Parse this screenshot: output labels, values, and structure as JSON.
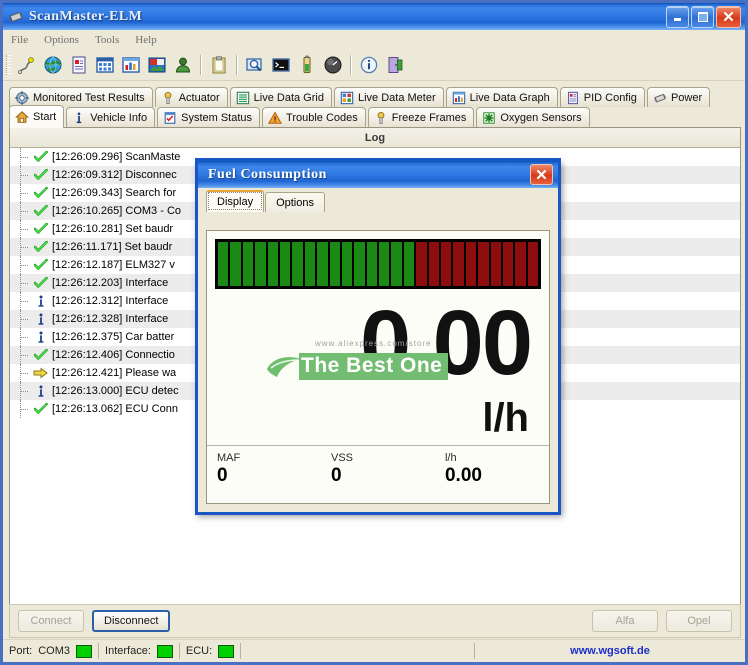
{
  "window": {
    "title": "ScanMaster-ELM",
    "icon": "chip-icon",
    "controls": {
      "minimize": "–",
      "maximize": "□",
      "close": "✕"
    }
  },
  "menubar": {
    "items": [
      "File",
      "Options",
      "Tools",
      "Help"
    ]
  },
  "toolbar": {
    "groups": [
      {
        "buttons": [
          "connect-icon",
          "globe-icon",
          "report-icon",
          "grid-icon",
          "chart-icon",
          "image-icon",
          "user-icon"
        ]
      },
      {
        "buttons": [
          "clipboard-icon",
          "terminal-search-icon",
          "console-icon",
          "battery-icon",
          "gauge-icon"
        ]
      },
      {
        "buttons": [
          "info-icon",
          "exit-icon"
        ]
      }
    ]
  },
  "tabs_top": [
    {
      "label": "Monitored Test Results",
      "icon": "gear-icon",
      "active": false
    },
    {
      "label": "Actuator",
      "icon": "actuator-icon",
      "active": false
    },
    {
      "label": "Live Data Grid",
      "icon": "list-icon",
      "active": false
    },
    {
      "label": "Live Data Meter",
      "icon": "meter-icon",
      "active": false
    },
    {
      "label": "Live Data Graph",
      "icon": "bar-chart-icon",
      "active": false
    },
    {
      "label": "PID Config",
      "icon": "pid-icon",
      "active": false
    },
    {
      "label": "Power",
      "icon": "power-icon",
      "active": false
    }
  ],
  "tabs_bottom": [
    {
      "label": "Start",
      "icon": "home-icon",
      "active": true
    },
    {
      "label": "Vehicle Info",
      "icon": "info-i-icon",
      "active": false
    },
    {
      "label": "System Status",
      "icon": "checklist-icon",
      "active": false
    },
    {
      "label": "Trouble Codes",
      "icon": "warning-icon",
      "active": false
    },
    {
      "label": "Freeze Frames",
      "icon": "freeze-icon",
      "active": false
    },
    {
      "label": "Oxygen Sensors",
      "icon": "oxygen-icon",
      "active": false
    }
  ],
  "log": {
    "header": "Log",
    "rows": [
      {
        "icon": "check-icon",
        "text": "[12:26:09.296] ScanMaste"
      },
      {
        "icon": "check-icon",
        "text": "[12:26:09.312] Disconnec"
      },
      {
        "icon": "check-icon",
        "text": "[12:26:09.343] Search for"
      },
      {
        "icon": "check-icon",
        "text": "[12:26:10.265] COM3 - Co"
      },
      {
        "icon": "check-icon",
        "text": "[12:26:10.281] Set baudr"
      },
      {
        "icon": "check-icon",
        "text": "[12:26:11.171] Set baudr"
      },
      {
        "icon": "check-icon",
        "text": "[12:26:12.187] ELM327 v"
      },
      {
        "icon": "check-icon",
        "text": "[12:26:12.203] Interface"
      },
      {
        "icon": "info-icon",
        "text": "[12:26:12.312] Interface"
      },
      {
        "icon": "info-icon",
        "text": "[12:26:12.328] Interface"
      },
      {
        "icon": "info-icon",
        "text": "[12:26:12.375] Car batter"
      },
      {
        "icon": "check-icon",
        "text": "[12:26:12.406] Connectio"
      },
      {
        "icon": "arrow-icon",
        "text": "[12:26:12.421] Please wa"
      },
      {
        "icon": "info-icon",
        "text": "[12:26:13.000] ECU detec"
      },
      {
        "icon": "check-icon",
        "text": "[12:26:13.062] ECU Conn"
      }
    ]
  },
  "buttons": {
    "connect": {
      "label": "Connect",
      "state": "disabled"
    },
    "disconnect": {
      "label": "Disconnect",
      "state": "default"
    },
    "alfa": {
      "label": "Alfa",
      "state": "disabled"
    },
    "opel": {
      "label": "Opel",
      "state": "disabled"
    }
  },
  "statusbar": {
    "port_label": "Port:",
    "port_value": "COM3",
    "port_led": "#00d000",
    "interface_label": "Interface:",
    "interface_led": "#00d000",
    "ecu_label": "ECU:",
    "ecu_led": "#00d000",
    "url": "www.wgsoft.de"
  },
  "fuel_dialog": {
    "title": "Fuel Consumption",
    "close_glyph": "✕",
    "tabs": [
      {
        "label": "Display",
        "active": true
      },
      {
        "label": "Options",
        "active": false
      }
    ],
    "bargraph": {
      "total_bars": 26,
      "green_bars": 16,
      "green_color": "#1a8a14",
      "red_color": "#8d0c0c",
      "background": "#000000"
    },
    "big_value": "0.00",
    "big_unit": "l/h",
    "watermark": {
      "text": "The Best One",
      "url": "www.aliexpress.com/store"
    },
    "readouts": [
      {
        "label": "MAF",
        "value": "0"
      },
      {
        "label": "VSS",
        "value": "0"
      },
      {
        "label": "l/h",
        "value": "0.00"
      }
    ]
  }
}
